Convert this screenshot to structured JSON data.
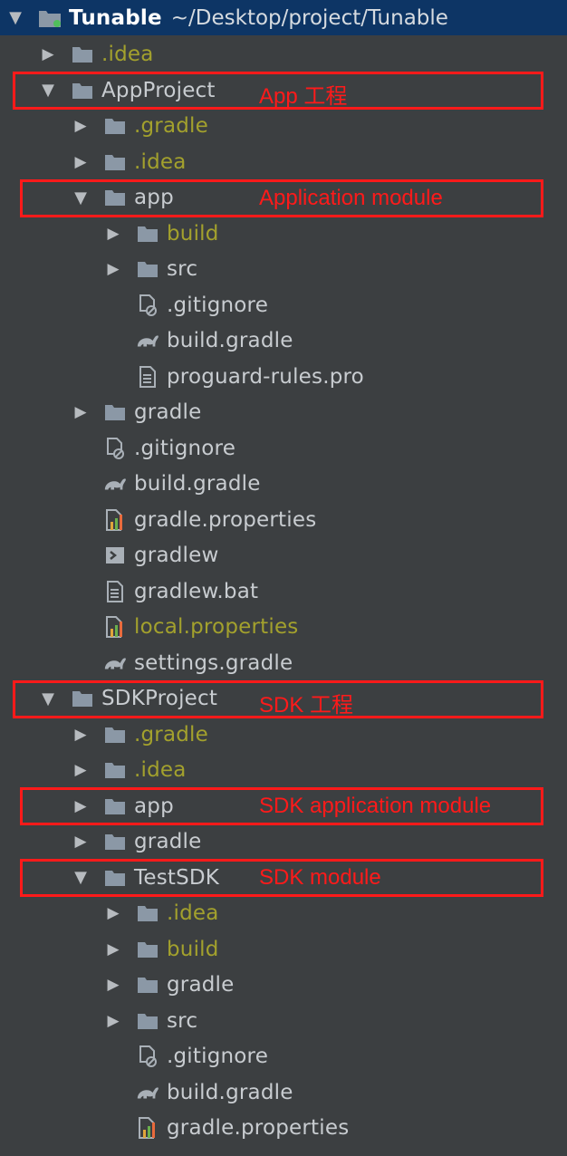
{
  "root": {
    "name": "Tunable",
    "path": "~/Desktop/project/Tunable"
  },
  "rows": [
    {
      "name": ".idea",
      "indent": 1,
      "state": "closed",
      "icon": "folder-icon",
      "olive": true
    },
    {
      "name": "AppProject",
      "indent": 1,
      "state": "open",
      "icon": "folder-icon",
      "olive": false
    },
    {
      "name": ".gradle",
      "indent": 2,
      "state": "closed",
      "icon": "folder-icon",
      "olive": true
    },
    {
      "name": ".idea",
      "indent": 2,
      "state": "closed",
      "icon": "folder-icon",
      "olive": true
    },
    {
      "name": "app",
      "indent": 2,
      "state": "open",
      "icon": "folder-icon",
      "olive": false
    },
    {
      "name": "build",
      "indent": 3,
      "state": "closed",
      "icon": "folder-icon",
      "olive": true
    },
    {
      "name": "src",
      "indent": 3,
      "state": "closed",
      "icon": "folder-icon",
      "olive": false
    },
    {
      "name": ".gitignore",
      "indent": 3,
      "state": "none",
      "icon": "gitignore-icon",
      "olive": false
    },
    {
      "name": "build.gradle",
      "indent": 3,
      "state": "none",
      "icon": "gradle-icon",
      "olive": false
    },
    {
      "name": "proguard-rules.pro",
      "indent": 3,
      "state": "none",
      "icon": "text-file-icon",
      "olive": false
    },
    {
      "name": "gradle",
      "indent": 2,
      "state": "closed",
      "icon": "folder-icon",
      "olive": false
    },
    {
      "name": ".gitignore",
      "indent": 2,
      "state": "none",
      "icon": "gitignore-icon",
      "olive": false
    },
    {
      "name": "build.gradle",
      "indent": 2,
      "state": "none",
      "icon": "gradle-icon",
      "olive": false
    },
    {
      "name": "gradle.properties",
      "indent": 2,
      "state": "none",
      "icon": "properties-icon",
      "olive": false
    },
    {
      "name": "gradlew",
      "indent": 2,
      "state": "none",
      "icon": "shell-script-icon",
      "olive": false
    },
    {
      "name": "gradlew.bat",
      "indent": 2,
      "state": "none",
      "icon": "text-file-icon",
      "olive": false
    },
    {
      "name": "local.properties",
      "indent": 2,
      "state": "none",
      "icon": "properties-icon",
      "olive": true
    },
    {
      "name": "settings.gradle",
      "indent": 2,
      "state": "none",
      "icon": "gradle-icon",
      "olive": false
    },
    {
      "name": "SDKProject",
      "indent": 1,
      "state": "open",
      "icon": "folder-icon",
      "olive": false
    },
    {
      "name": ".gradle",
      "indent": 2,
      "state": "closed",
      "icon": "folder-icon",
      "olive": true
    },
    {
      "name": ".idea",
      "indent": 2,
      "state": "closed",
      "icon": "folder-icon",
      "olive": true
    },
    {
      "name": "app",
      "indent": 2,
      "state": "closed",
      "icon": "folder-icon",
      "olive": false
    },
    {
      "name": "gradle",
      "indent": 2,
      "state": "closed",
      "icon": "folder-icon",
      "olive": false
    },
    {
      "name": "TestSDK",
      "indent": 2,
      "state": "open",
      "icon": "folder-icon",
      "olive": false
    },
    {
      "name": ".idea",
      "indent": 3,
      "state": "closed",
      "icon": "folder-icon",
      "olive": true
    },
    {
      "name": "build",
      "indent": 3,
      "state": "closed",
      "icon": "folder-icon",
      "olive": true
    },
    {
      "name": "gradle",
      "indent": 3,
      "state": "closed",
      "icon": "folder-icon",
      "olive": false
    },
    {
      "name": "src",
      "indent": 3,
      "state": "closed",
      "icon": "folder-icon",
      "olive": false
    },
    {
      "name": ".gitignore",
      "indent": 3,
      "state": "none",
      "icon": "gitignore-icon",
      "olive": false
    },
    {
      "name": "build.gradle",
      "indent": 3,
      "state": "none",
      "icon": "gradle-icon",
      "olive": false
    },
    {
      "name": "gradle.properties",
      "indent": 3,
      "state": "none",
      "icon": "properties-icon",
      "olive": false
    }
  ],
  "annotations": [
    {
      "row": 2,
      "text": "App 工程"
    },
    {
      "row": 5,
      "text": "Application module"
    },
    {
      "row": 19,
      "text": "SDK 工程"
    },
    {
      "row": 22,
      "text": "SDK application module"
    },
    {
      "row": 24,
      "text": "SDK module"
    }
  ],
  "colors": {
    "background": "#3c3f41",
    "selection": "#0d3565",
    "excluded_text": "#a3a12d",
    "annotation": "#ff1a1a"
  }
}
